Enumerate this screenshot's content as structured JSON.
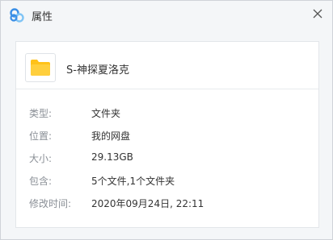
{
  "window": {
    "title": "属性"
  },
  "file": {
    "name": "S-神探夏洛克"
  },
  "properties": [
    {
      "label": "类型:",
      "value": "文件夹"
    },
    {
      "label": "位置:",
      "value": "我的网盘"
    },
    {
      "label": "大小:",
      "value": "29.13GB"
    },
    {
      "label": "包含:",
      "value": "5个文件,1个文件夹"
    },
    {
      "label": "修改时间:",
      "value": "2020年09月24日, 22:11"
    }
  ],
  "colors": {
    "folder": "#ffc21a",
    "logo_blue": "#3a8ee6",
    "logo_light": "#7fc4f5"
  },
  "icons": {
    "logo": "baidu-netdisk-logo-icon",
    "close": "close-icon",
    "folder": "folder-icon"
  }
}
